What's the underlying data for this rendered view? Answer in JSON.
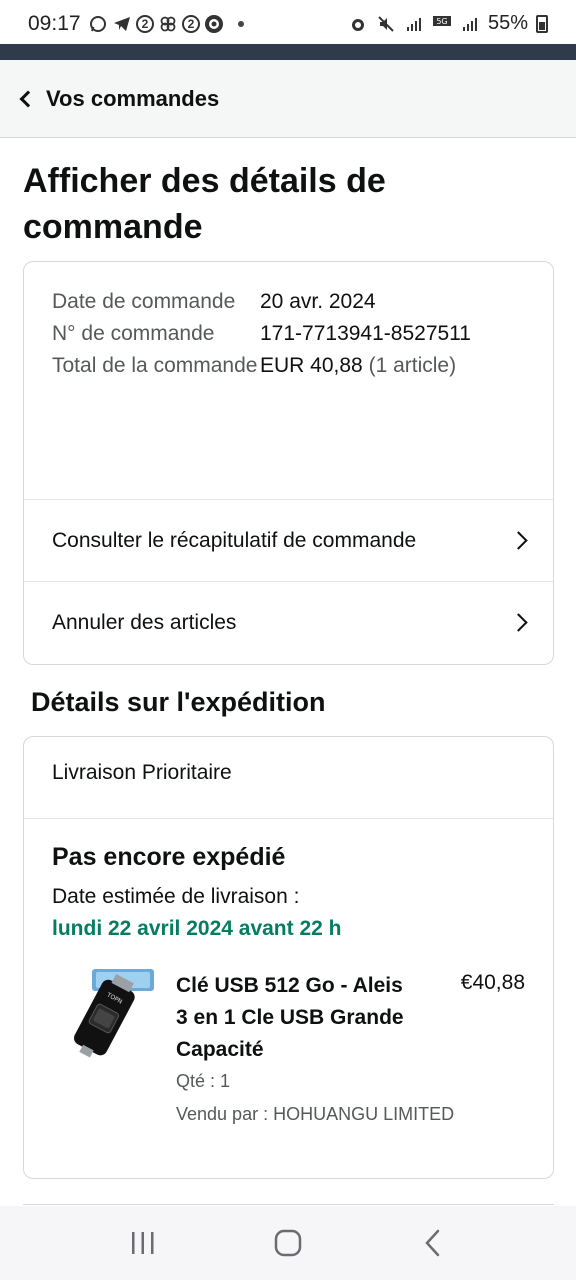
{
  "status_bar": {
    "time": "09:17",
    "left_icons": [
      "whatsapp-icon",
      "telegram-icon",
      "notification-2-icon",
      "pinwheel-icon",
      "notification-2-icon",
      "app-badge-icon"
    ],
    "notif_count_a": "2",
    "notif_count_b": "2",
    "right_icons": [
      "alarm-icon",
      "mute-icon",
      "signal-icon",
      "5g-icon",
      "signal-icon",
      "battery-icon"
    ],
    "battery": "55%"
  },
  "header": {
    "back_label": "Vos commandes"
  },
  "page_title": "Afficher des détails de commande",
  "order_info": {
    "rows": [
      {
        "label": "Date de commande",
        "value": "20 avr. 2024",
        "extra": ""
      },
      {
        "label": "N° de commande",
        "value": "171-7713941-8527511",
        "extra": ""
      },
      {
        "label": "Total de la commande",
        "value": "EUR 40,88",
        "extra": "(1 article)"
      }
    ]
  },
  "links": {
    "summary": "Consulter le récapitulatif de commande",
    "cancel": "Annuler des articles"
  },
  "shipping": {
    "section_title": "Détails sur l'expédition",
    "method": "Livraison Prioritaire",
    "status": "Pas encore expédié",
    "estimate_label": "Date estimée de livraison :",
    "estimate_date": "lundi 22 avril 2024 avant 22 h"
  },
  "product": {
    "title": "Clé USB 512 Go - Aleis 3 en 1 Cle USB Grande Capacité",
    "price": "€40,88",
    "qty": "Qté : 1",
    "seller": "Vendu par : HOHUANGU LIMITED",
    "image_brand": "TOPN"
  },
  "navbar": {
    "icons": [
      "recent-apps-icon",
      "home-icon",
      "back-icon"
    ]
  }
}
